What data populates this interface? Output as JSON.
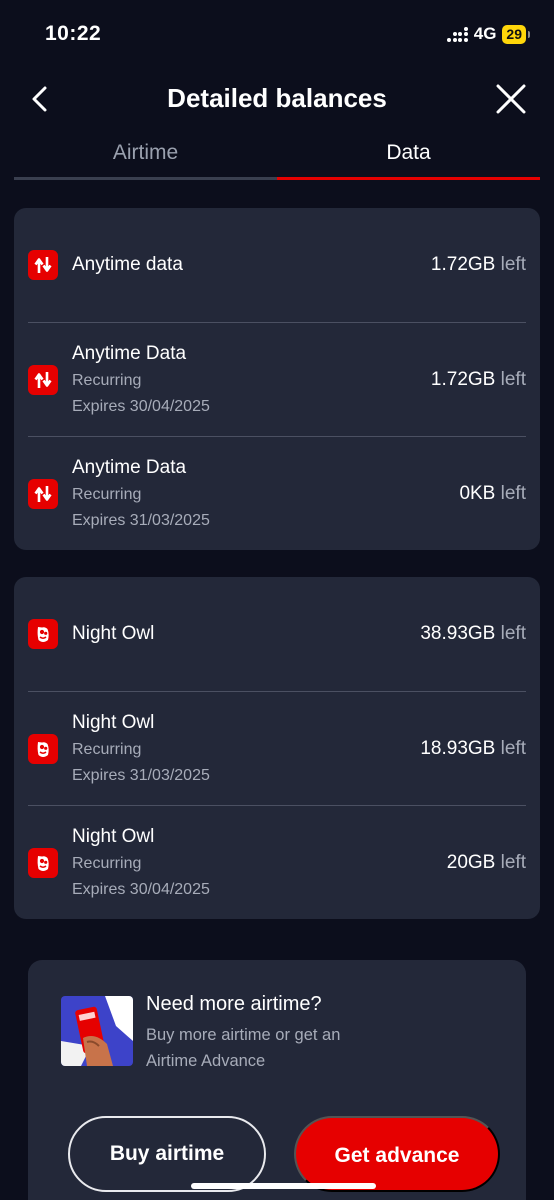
{
  "status": {
    "time": "10:22",
    "network": "4G",
    "battery": "29"
  },
  "header": {
    "title": "Detailed balances"
  },
  "tabs": [
    {
      "label": "Airtime",
      "active": false
    },
    {
      "label": "Data",
      "active": true
    }
  ],
  "data_card": {
    "items": [
      {
        "name": "Anytime data",
        "amount": "1.72GB",
        "unit": "left",
        "icon": "data-arrows-icon"
      },
      {
        "name": "Anytime Data",
        "type": "Recurring",
        "expires": "Expires 30/04/2025",
        "amount": "1.72GB",
        "unit": "left",
        "icon": "data-arrows-icon"
      },
      {
        "name": "Anytime Data",
        "type": "Recurring",
        "expires": "Expires 31/03/2025",
        "amount": "0KB",
        "unit": "left",
        "icon": "data-arrows-icon"
      }
    ]
  },
  "owl_card": {
    "items": [
      {
        "name": "Night Owl",
        "amount": "38.93GB",
        "unit": "left",
        "icon": "owl-icon"
      },
      {
        "name": "Night Owl",
        "type": "Recurring",
        "expires": "Expires 31/03/2025",
        "amount": "18.93GB",
        "unit": "left",
        "icon": "owl-icon"
      },
      {
        "name": "Night Owl",
        "type": "Recurring",
        "expires": "Expires 30/04/2025",
        "amount": "20GB",
        "unit": "left",
        "icon": "owl-icon"
      }
    ]
  },
  "promo": {
    "title": "Need more airtime?",
    "subtitle": "Buy more airtime or get an Airtime Advance",
    "buy_label": "Buy airtime",
    "advance_label": "Get advance"
  },
  "colors": {
    "accent": "#e60000",
    "background": "#0c0e1c",
    "card": "#232839"
  }
}
